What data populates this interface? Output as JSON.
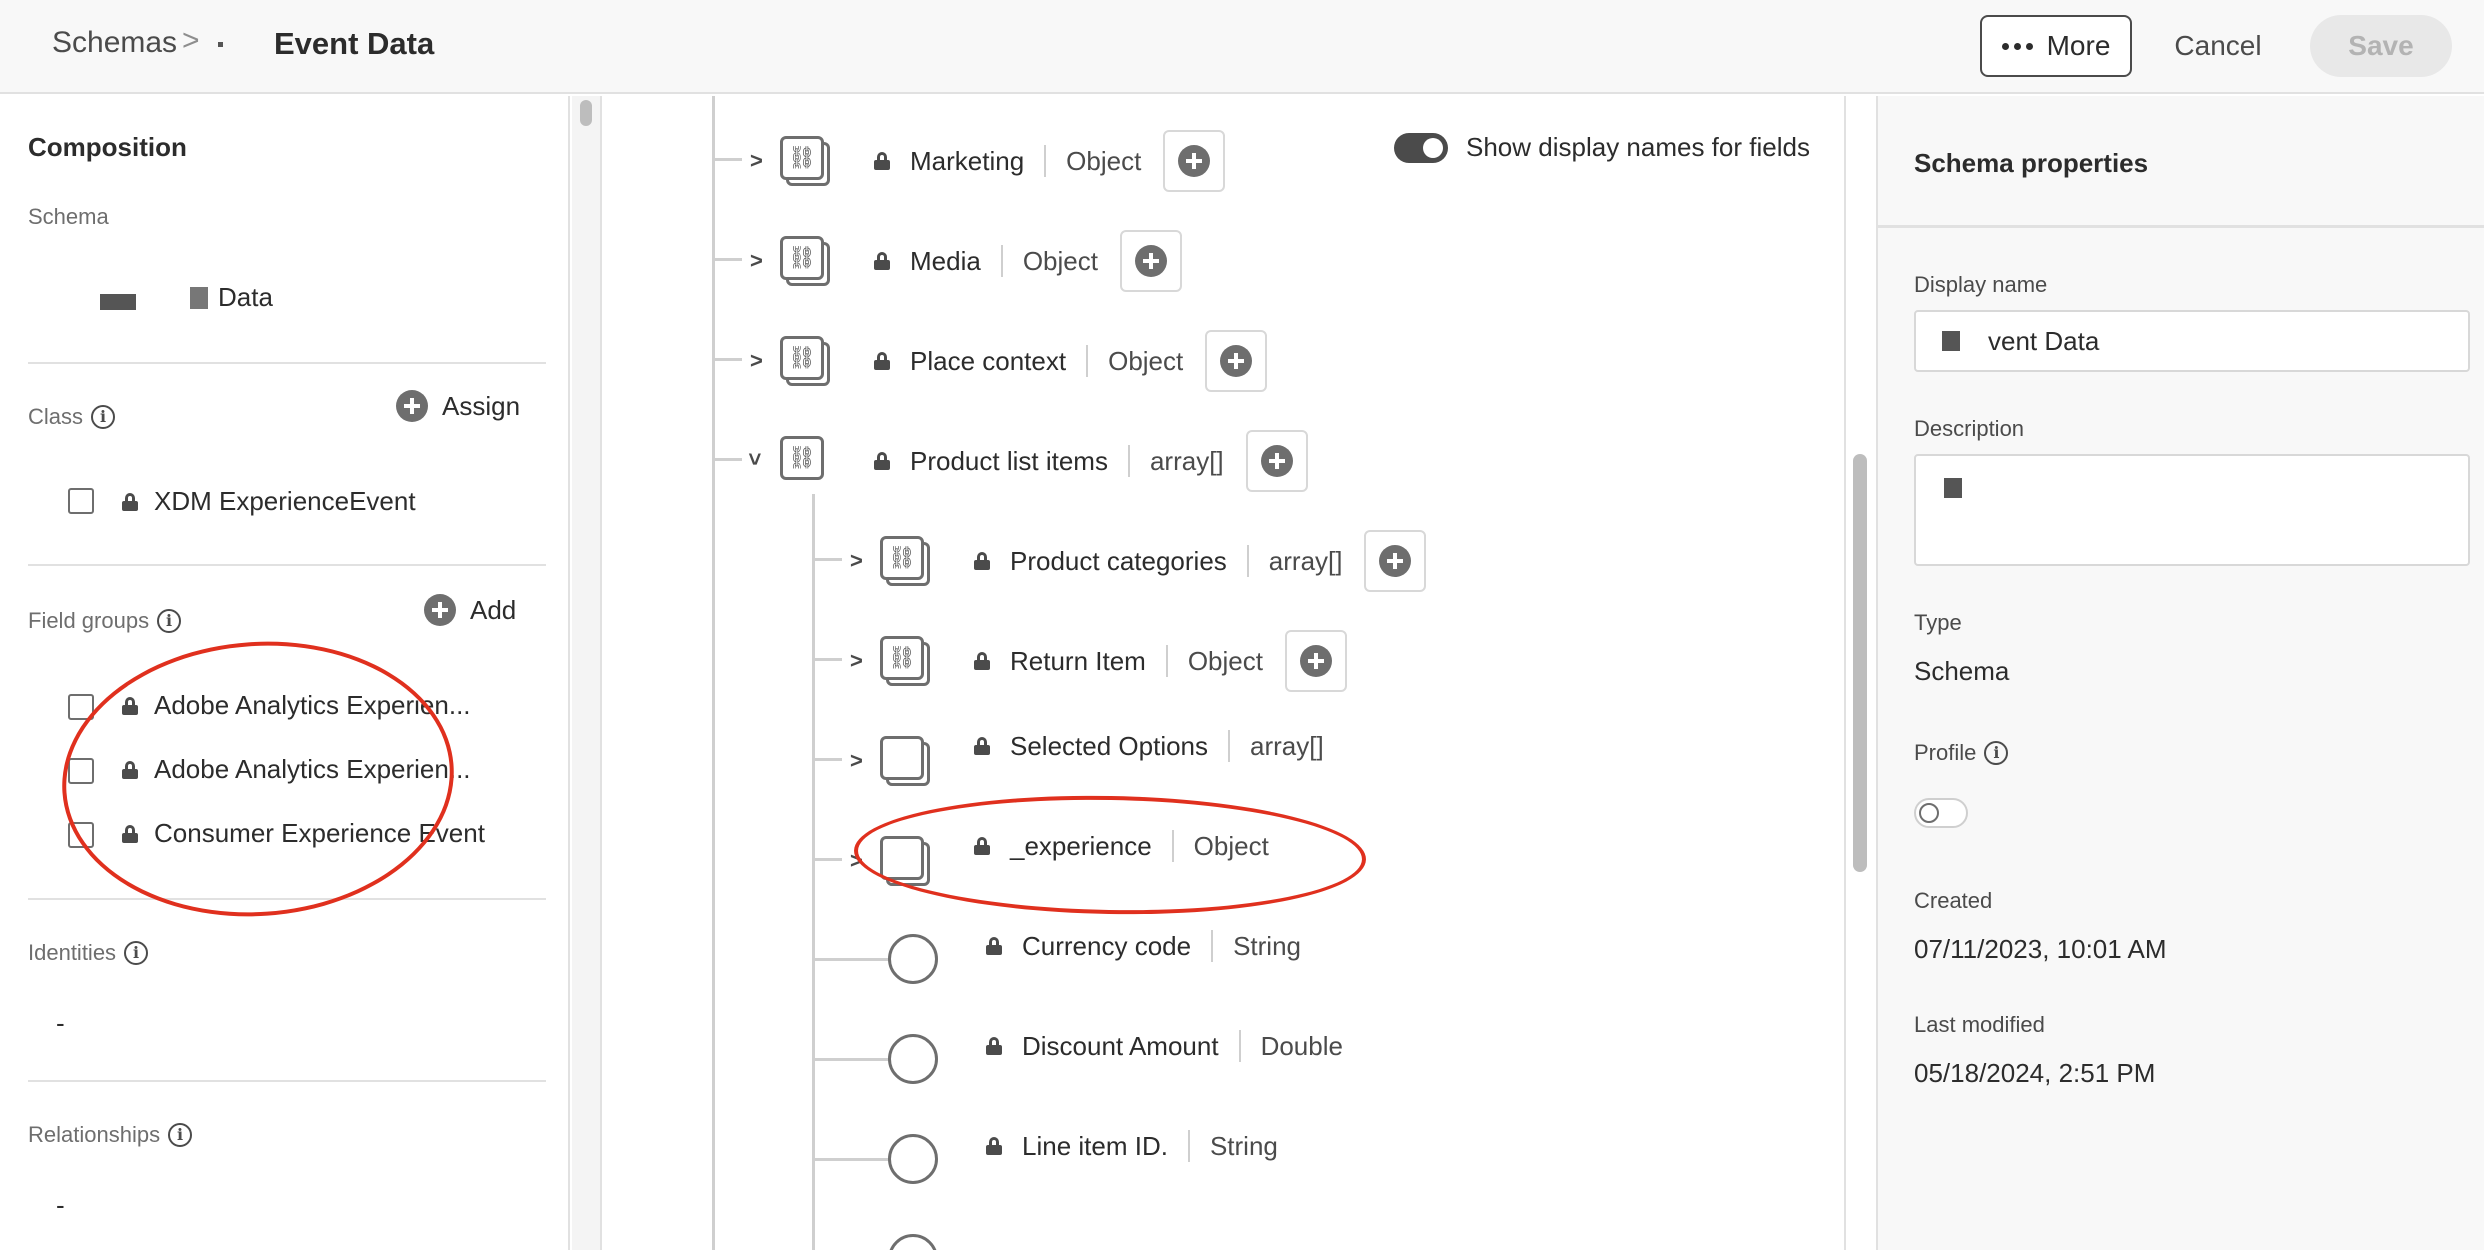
{
  "breadcrumb": {
    "root": "Schemas",
    "separator": ">",
    "current": "Event Data"
  },
  "toolbar": {
    "more_label": "More",
    "cancel_label": "Cancel",
    "save_label": "Save"
  },
  "composition": {
    "title": "Composition",
    "schema_label": "Schema",
    "schema_value": "Data",
    "class_label": "Class",
    "class_action": "Assign",
    "class_item": "XDM ExperienceEvent",
    "field_groups_label": "Field groups",
    "field_groups_action": "Add",
    "field_groups": [
      "Adobe Analytics Experien...",
      "Adobe Analytics Experien...",
      "Consumer Experience Event"
    ],
    "identities_label": "Identities",
    "identities_value": "-",
    "relationships_label": "Relationships",
    "relationships_value": "-"
  },
  "tree": {
    "show_display_names_label": "Show display names for fields",
    "show_display_names_on": true,
    "nodes": [
      {
        "name": "Marketing",
        "type": "Object"
      },
      {
        "name": "Media",
        "type": "Object"
      },
      {
        "name": "Place context",
        "type": "Object"
      },
      {
        "name": "Product list items",
        "type": "array[]"
      },
      {
        "name": "Product categories",
        "type": "array[]"
      },
      {
        "name": "Return Item",
        "type": "Object"
      },
      {
        "name": "Selected Options",
        "type": "array[]"
      },
      {
        "name": "_experience",
        "type": "Object"
      },
      {
        "name": "Currency code",
        "type": "String"
      },
      {
        "name": "Discount Amount",
        "type": "Double"
      },
      {
        "name": "Line item ID.",
        "type": "String"
      }
    ]
  },
  "properties": {
    "title": "Schema properties",
    "display_name_label": "Display name",
    "display_name_value": "vent Data",
    "description_label": "Description",
    "type_label": "Type",
    "type_value": "Schema",
    "profile_label": "Profile",
    "profile_enabled": false,
    "created_label": "Created",
    "created_value": "07/11/2023, 10:01 AM",
    "last_modified_label": "Last modified",
    "last_modified_value": "05/18/2024, 2:51 PM"
  },
  "colors": {
    "annotation": "#e0301e",
    "save_disabled_bg": "#e8e8e8"
  },
  "icons": {
    "more": "ellipsis-icon",
    "info": "info-icon",
    "add": "add-circle-icon",
    "lock": "lock-icon",
    "link": "link-icon",
    "chevron": "chevron-icon"
  }
}
